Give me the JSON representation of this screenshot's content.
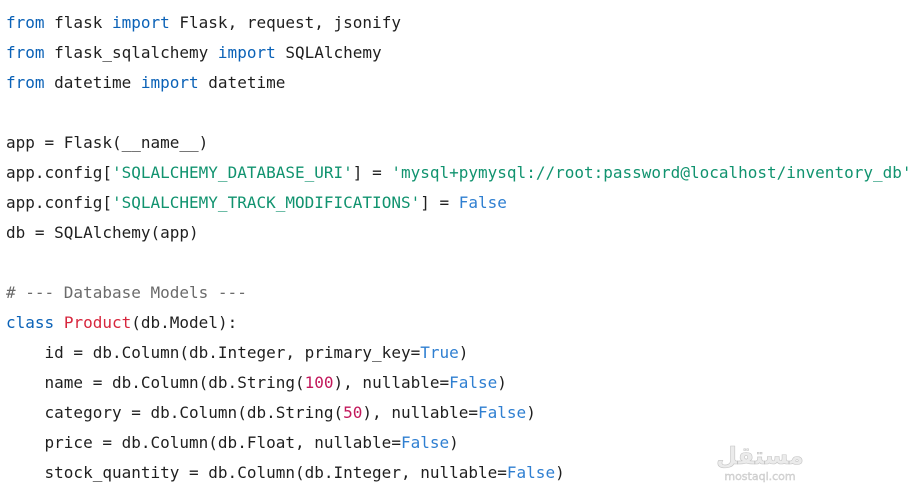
{
  "code_lines": [
    [
      {
        "t": "from",
        "c": "keyword"
      },
      {
        "t": " flask ",
        "c": "plain"
      },
      {
        "t": "import",
        "c": "keyword"
      },
      {
        "t": " Flask, request, jsonify",
        "c": "plain"
      }
    ],
    [
      {
        "t": "from",
        "c": "keyword"
      },
      {
        "t": " flask_sqlalchemy ",
        "c": "plain"
      },
      {
        "t": "import",
        "c": "keyword"
      },
      {
        "t": " SQLAlchemy",
        "c": "plain"
      }
    ],
    [
      {
        "t": "from",
        "c": "keyword"
      },
      {
        "t": " datetime ",
        "c": "plain"
      },
      {
        "t": "import",
        "c": "keyword"
      },
      {
        "t": " datetime",
        "c": "plain"
      }
    ],
    [
      {
        "t": "",
        "c": "plain"
      }
    ],
    [
      {
        "t": "app = Flask(__name__)",
        "c": "plain"
      }
    ],
    [
      {
        "t": "app.config[",
        "c": "plain"
      },
      {
        "t": "'SQLALCHEMY_DATABASE_URI'",
        "c": "string"
      },
      {
        "t": "] = ",
        "c": "plain"
      },
      {
        "t": "'mysql+pymysql://root:password@localhost/inventory_db'",
        "c": "string"
      }
    ],
    [
      {
        "t": "app.config[",
        "c": "plain"
      },
      {
        "t": "'SQLALCHEMY_TRACK_MODIFICATIONS'",
        "c": "string"
      },
      {
        "t": "] = ",
        "c": "plain"
      },
      {
        "t": "False",
        "c": "constant"
      }
    ],
    [
      {
        "t": "db = SQLAlchemy(app)",
        "c": "plain"
      }
    ],
    [
      {
        "t": "",
        "c": "plain"
      }
    ],
    [
      {
        "t": "# --- Database Models ---",
        "c": "comment"
      }
    ],
    [
      {
        "t": "class",
        "c": "keyword"
      },
      {
        "t": " ",
        "c": "plain"
      },
      {
        "t": "Product",
        "c": "class"
      },
      {
        "t": "(db.Model):",
        "c": "plain"
      }
    ],
    [
      {
        "t": "    id = db.Column(db.Integer, primary_key=",
        "c": "plain"
      },
      {
        "t": "True",
        "c": "constant"
      },
      {
        "t": ")",
        "c": "plain"
      }
    ],
    [
      {
        "t": "    name = db.Column(db.String(",
        "c": "plain"
      },
      {
        "t": "100",
        "c": "number"
      },
      {
        "t": "), nullable=",
        "c": "plain"
      },
      {
        "t": "False",
        "c": "constant"
      },
      {
        "t": ")",
        "c": "plain"
      }
    ],
    [
      {
        "t": "    category = db.Column(db.String(",
        "c": "plain"
      },
      {
        "t": "50",
        "c": "number"
      },
      {
        "t": "), nullable=",
        "c": "plain"
      },
      {
        "t": "False",
        "c": "constant"
      },
      {
        "t": ")",
        "c": "plain"
      }
    ],
    [
      {
        "t": "    price = db.Column(db.Float, nullable=",
        "c": "plain"
      },
      {
        "t": "False",
        "c": "constant"
      },
      {
        "t": ")",
        "c": "plain"
      }
    ],
    [
      {
        "t": "    stock_quantity = db.Column(db.Integer, nullable=",
        "c": "plain"
      },
      {
        "t": "False",
        "c": "constant"
      },
      {
        "t": ")",
        "c": "plain"
      }
    ]
  ],
  "watermark": {
    "line1": "مستقل",
    "line2": "mostaql.com"
  },
  "colors": {
    "keyword": "#0b62b7",
    "class": "#d7263d",
    "string": "#11936f",
    "number": "#c2185b",
    "constant": "#2f7fd1",
    "comment": "#6b6b6b",
    "plain": "#1f1f1f",
    "background": "#ffffff"
  }
}
